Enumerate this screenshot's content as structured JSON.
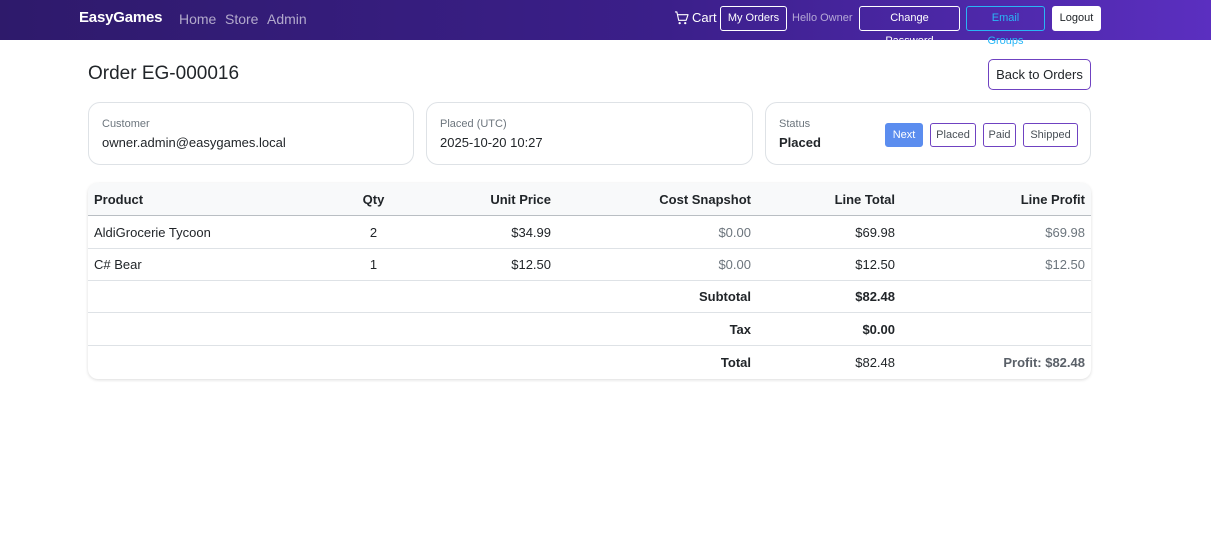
{
  "navbar": {
    "brand": "EasyGames",
    "links": [
      "Home",
      "Store",
      "Admin"
    ],
    "cart_label": "Cart",
    "my_orders": "My Orders",
    "greeting": "Hello Owner",
    "change_password": "Change Password",
    "email_groups": "Email Groups",
    "logout": "Logout"
  },
  "header": {
    "title": "Order EG-000016",
    "back_button": "Back to Orders"
  },
  "info": {
    "customer_label": "Customer",
    "customer_value": "owner.admin@easygames.local",
    "placed_label": "Placed (UTC)",
    "placed_value": "2025-10-20 10:27",
    "status_label": "Status",
    "status_value": "Placed",
    "status_buttons": [
      "Next",
      "Placed",
      "Paid",
      "Shipped"
    ]
  },
  "table": {
    "headers": [
      "Product",
      "Qty",
      "Unit Price",
      "Cost Snapshot",
      "Line Total",
      "Line Profit"
    ],
    "rows": [
      [
        "AldiGrocerie Tycoon",
        "2",
        "$34.99",
        "$0.00",
        "$69.98",
        "$69.98"
      ],
      [
        "C# Bear",
        "1",
        "$12.50",
        "$0.00",
        "$12.50",
        "$12.50"
      ]
    ],
    "summary": {
      "subtotal_label": "Subtotal",
      "subtotal_value": "$82.48",
      "tax_label": "Tax",
      "tax_value": "$0.00",
      "total_label": "Total",
      "total_value": "$82.48",
      "profit_total": "Profit: $82.48"
    }
  },
  "colors": {
    "navbar_start": "#2e1a6b",
    "navbar_end": "#5b2fc0",
    "accent_outline": "#6f42c1",
    "next_button": "#5b8def",
    "email_groups": "#29b6f6"
  }
}
